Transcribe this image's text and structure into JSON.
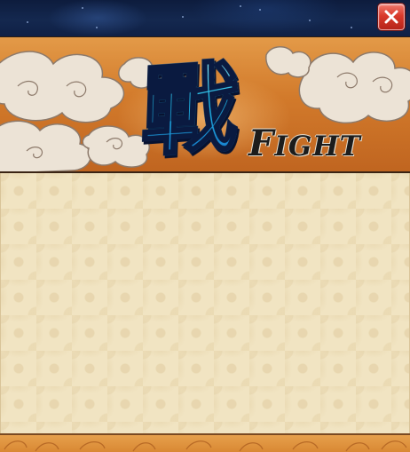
{
  "window": {
    "close_icon": "close-icon"
  },
  "banner": {
    "character": "戰",
    "word_first_letter": "F",
    "word_rest": "IGHT"
  },
  "colors": {
    "titlebar": "#14284f",
    "banner_orange": "#d27a2b",
    "character_cyan": "#22c4ef",
    "parchment": "#f1e4c2",
    "close_red": "#d93a2b"
  }
}
